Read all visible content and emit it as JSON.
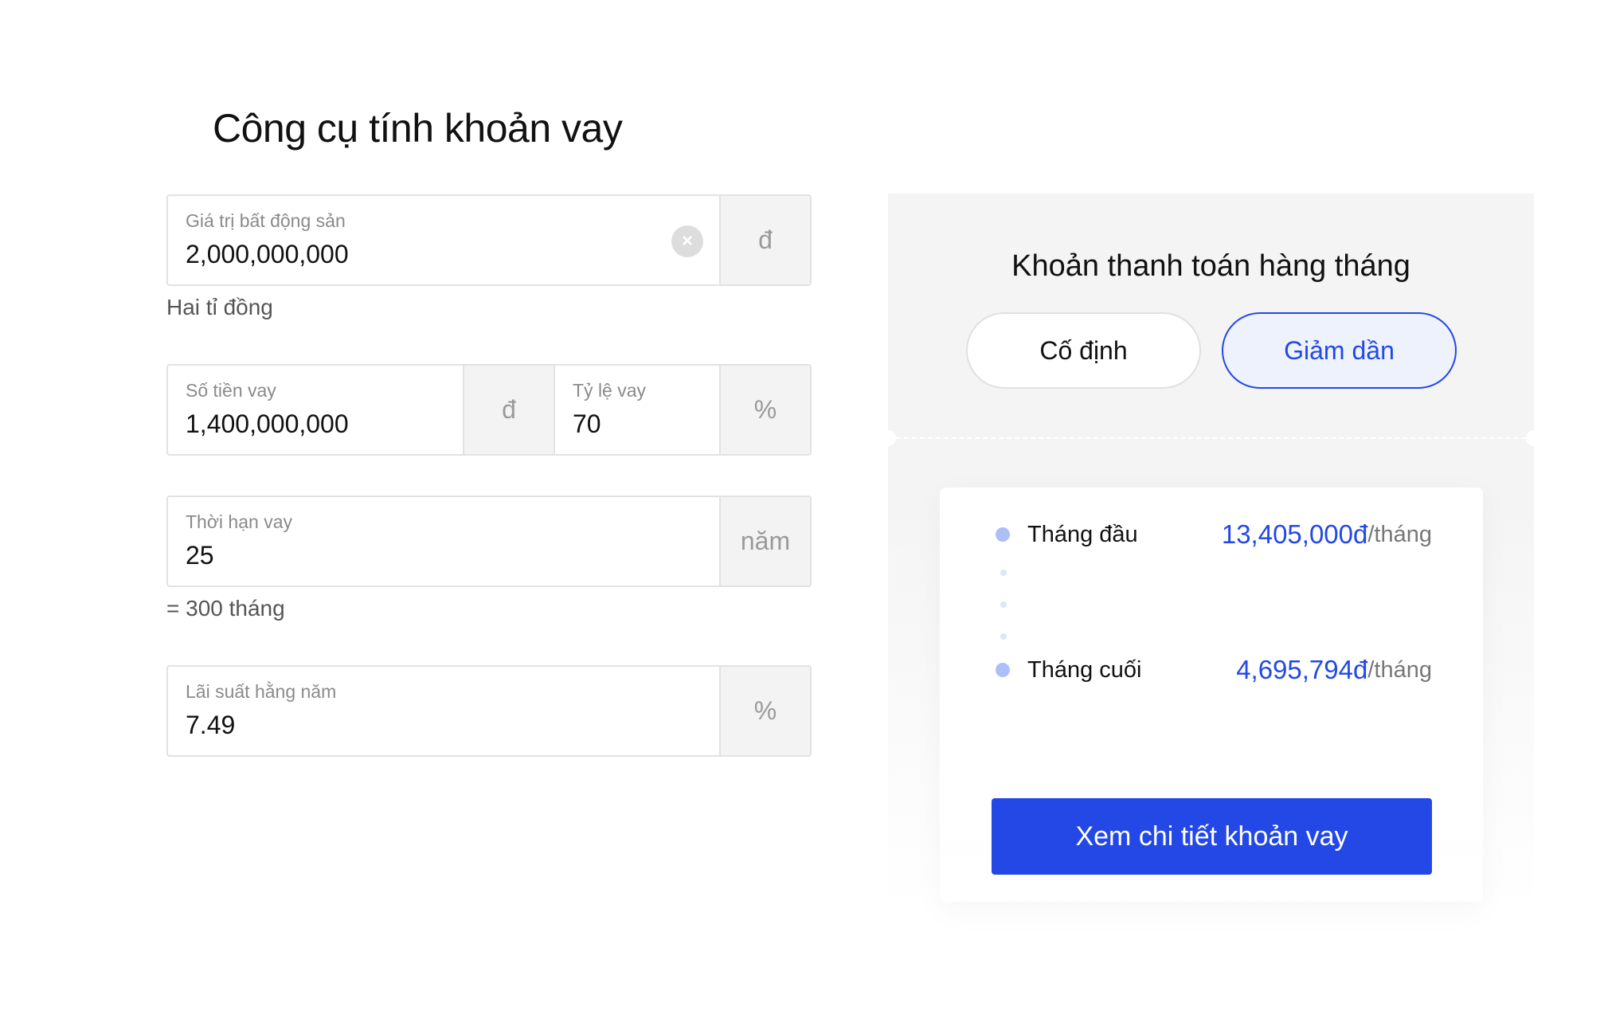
{
  "title": "Công cụ tính khoản vay",
  "property": {
    "label": "Giá trị bất động sản",
    "value": "2,000,000,000",
    "unit": "đ",
    "hint": "Hai tỉ đồng",
    "clear_icon": "×"
  },
  "loan": {
    "label": "Số tiền vay",
    "value": "1,400,000,000",
    "unit": "đ"
  },
  "ratio": {
    "label": "Tỷ lệ vay",
    "value": "70",
    "unit": "%"
  },
  "term": {
    "label": "Thời hạn vay",
    "value": "25",
    "unit": "năm",
    "hint": "= 300 tháng"
  },
  "rate": {
    "label": "Lãi suất hằng năm",
    "value": "7.49",
    "unit": "%"
  },
  "panel": {
    "heading": "Khoản thanh toán hàng tháng",
    "toggle": [
      {
        "label": "Cố định",
        "selected": false
      },
      {
        "label": "Giảm dần",
        "selected": true
      }
    ],
    "rows": [
      {
        "label": "Tháng đầu",
        "value": "13,405,000đ",
        "unit": "/tháng"
      },
      {
        "label": "Tháng cuối",
        "value": "4,695,794đ",
        "unit": "/tháng"
      }
    ],
    "cta": "Xem chi tiết khoản vay"
  },
  "colors": {
    "accent": "#2348e6",
    "dot": "#aebff7"
  }
}
